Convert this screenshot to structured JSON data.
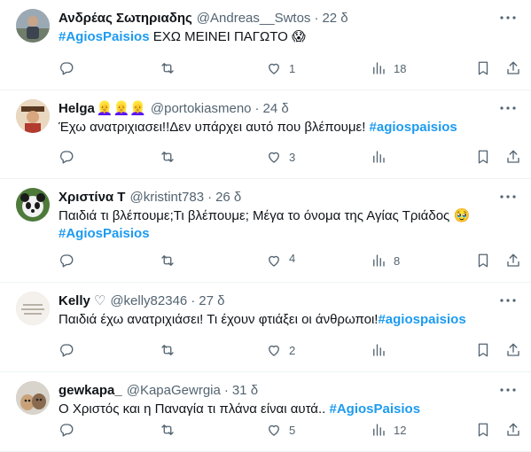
{
  "tweets": [
    {
      "name": "Ανδρέας Σωτηριαδης",
      "name_suffix": "",
      "handle": "@Andreas__Swtos",
      "time": "22 δ",
      "text_before": "",
      "hashtag_lead": "#AgiosPaisios",
      "text_after": " ΕΧΩ ΜΕΙΝΕΙ ΠΑΓΩΤΟ ",
      "emoji": "😱",
      "hashtag_tail": "",
      "hashtag_line2": "",
      "replies": "",
      "retweets": "",
      "likes": "1",
      "views": "18"
    },
    {
      "name": "Helga",
      "name_suffix": "👱‍♀️👱‍♀️👱‍♀️",
      "handle": "@portokiasmeno",
      "time": "24 δ",
      "text_before": "Έχω ανατριχιασει!!Δεν υπάρχει αυτό που βλέπουμε! ",
      "hashtag_lead": "",
      "text_after": "",
      "emoji": "",
      "hashtag_tail": "#agiospaisios",
      "hashtag_line2": "",
      "replies": "",
      "retweets": "",
      "likes": "3",
      "views": ""
    },
    {
      "name": "Χριστίνα Τ",
      "name_suffix": "",
      "handle": "@kristint783",
      "time": "26 δ",
      "text_before": "Παιδιά τι βλέπουμε;Τι βλέπουμε; Μέγα το όνομα της Αγίας Τριάδος ",
      "hashtag_lead": "",
      "text_after": "",
      "emoji": "🥹",
      "hashtag_tail": "",
      "hashtag_line2": "#AgiosPaisios",
      "replies": "",
      "retweets": "",
      "likes": "4",
      "views": "8"
    },
    {
      "name": "Kelly",
      "name_suffix": "♡",
      "handle": "@kelly82346",
      "time": "27 δ",
      "text_before": "Παιδιά έχω ανατριχιάσει! Τι έχουν φτιάξει οι άνθρωποι!",
      "hashtag_lead": "",
      "text_after": "",
      "emoji": "",
      "hashtag_tail": "#agiospaisios",
      "hashtag_line2": "",
      "replies": "",
      "retweets": "",
      "likes": "2",
      "views": ""
    },
    {
      "name": "gewkapa_",
      "name_suffix": "",
      "handle": "@KapaGewrgia",
      "time": "31 δ",
      "text_before": "Ο Χριστός και η Παναγία τι πλάνα είναι αυτά.. ",
      "hashtag_lead": "",
      "text_after": "",
      "emoji": "",
      "hashtag_tail": "#AgiosPaisios",
      "hashtag_line2": "",
      "replies": "",
      "retweets": "",
      "likes": "5",
      "views": "12"
    }
  ],
  "dot_separator": "·",
  "icons": {
    "more": "more-horizontal-icon",
    "reply": "reply-bubble-icon",
    "retweet": "retweet-icon",
    "like": "heart-icon",
    "views": "views-bar-chart-icon",
    "bookmark": "bookmark-icon",
    "share": "share-upload-icon"
  },
  "colors": {
    "text": "#0f1419",
    "secondary": "#536471",
    "hashtag": "#1d9bf0",
    "divider": "#eff3f4"
  }
}
